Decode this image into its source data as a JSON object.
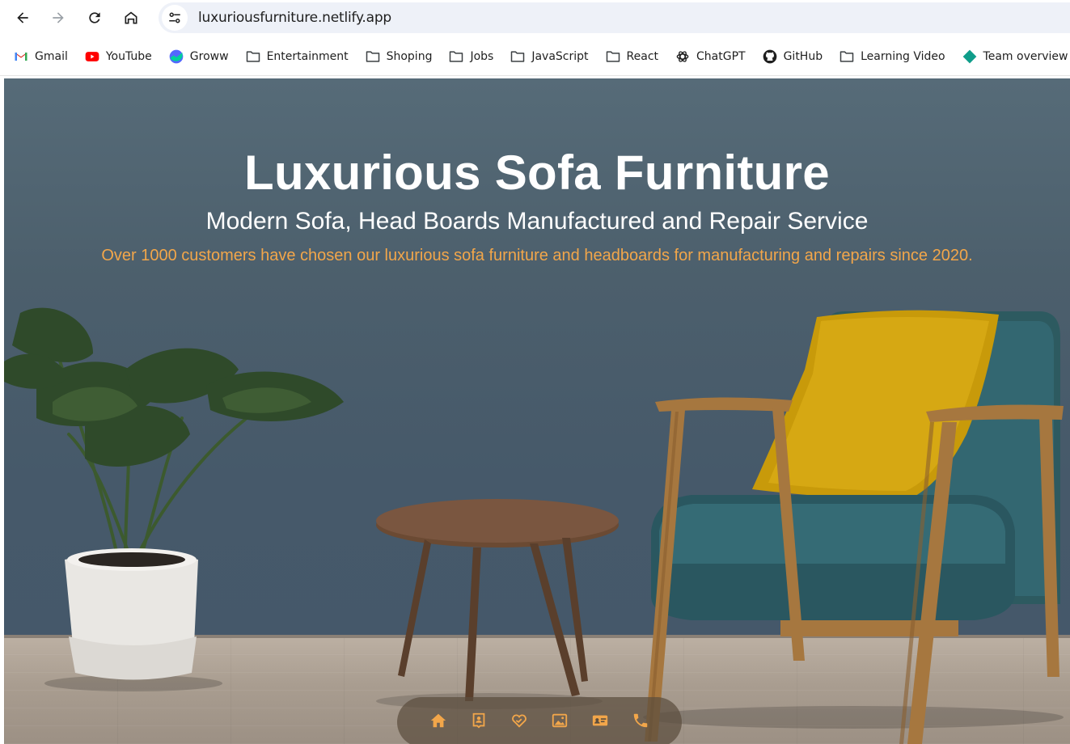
{
  "browser": {
    "url": "luxuriousfurniture.netlify.app",
    "icons": {
      "back": "arrow-left-icon",
      "forward": "arrow-right-icon",
      "reload": "reload-icon",
      "home": "home-icon",
      "site_info": "tune-icon"
    }
  },
  "bookmarks": [
    {
      "label": "Gmail",
      "icon": "gmail-icon"
    },
    {
      "label": "YouTube",
      "icon": "youtube-icon"
    },
    {
      "label": "Groww",
      "icon": "groww-icon"
    },
    {
      "label": "Entertainment",
      "icon": "folder-icon"
    },
    {
      "label": "Shoping",
      "icon": "folder-icon"
    },
    {
      "label": "Jobs",
      "icon": "folder-icon"
    },
    {
      "label": "JavaScript",
      "icon": "folder-icon"
    },
    {
      "label": "React",
      "icon": "folder-icon"
    },
    {
      "label": "ChatGPT",
      "icon": "chatgpt-icon"
    },
    {
      "label": "GitHub",
      "icon": "github-icon"
    },
    {
      "label": "Learning Video",
      "icon": "folder-icon"
    },
    {
      "label": "Team overview",
      "icon": "diamond-icon"
    }
  ],
  "hero": {
    "title": "Luxurious Sofa Furniture",
    "subtitle": "Modern Sofa, Head Boards Manufactured and Repair Service",
    "tagline": "Over 1000 customers have chosen our luxurious sofa furniture and headboards for manufacturing and repairs since 2020."
  },
  "dock": {
    "items": [
      "home-icon",
      "about-icon",
      "services-icon",
      "gallery-icon",
      "contact-card-icon",
      "phone-icon"
    ],
    "icon_color": "#f2a64a"
  },
  "colors": {
    "wall": "#4c5f6c",
    "accent": "#f2a64a",
    "title": "#ffffff"
  }
}
